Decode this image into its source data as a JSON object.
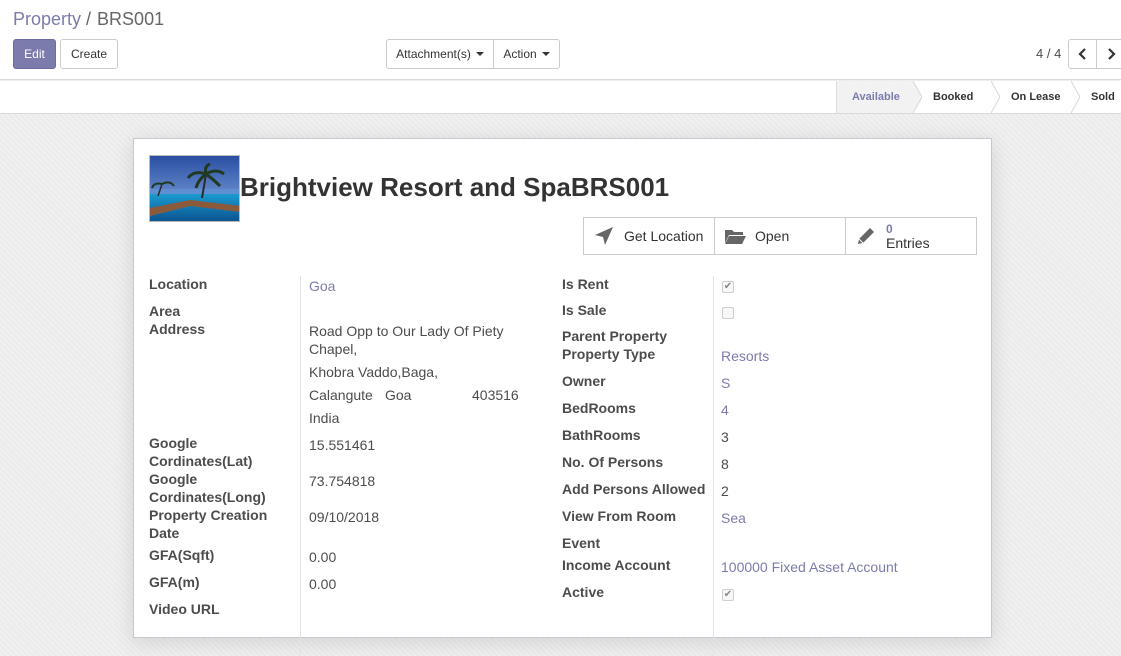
{
  "breadcrumb": {
    "parent": "Property",
    "separator": "/",
    "current": "BRS001"
  },
  "toolbar": {
    "edit_label": "Edit",
    "create_label": "Create",
    "attachments_label": "Attachment(s)",
    "action_label": "Action"
  },
  "pager": {
    "value": "4 / 4"
  },
  "stages": [
    {
      "label": "Available",
      "active": true
    },
    {
      "label": "Booked",
      "active": false
    },
    {
      "label": "On Lease",
      "active": false
    },
    {
      "label": "Sold",
      "active": false
    }
  ],
  "record": {
    "title": "Brightview Resort and SpaBRS001"
  },
  "smart_buttons": {
    "get_location": "Get Location",
    "open": "Open",
    "entries_count": "0",
    "entries_label": "Entries"
  },
  "left_fields": {
    "location_label": "Location",
    "location_value": "Goa",
    "area_label": "Area",
    "address_label": "Address",
    "address_street": "Road Opp to Our Lady Of Piety",
    "address_street_cont": "Chapel,",
    "address_street2": "Khobra Vaddo,Baga,",
    "address_city": "Calangute",
    "address_state": "Goa",
    "address_zip": "403516",
    "address_country": "India",
    "lat_label_1": "Google",
    "lat_label_2": "Cordinates(Lat)",
    "lat_value": "15.551461",
    "long_label_1": "Google",
    "long_label_2": "Cordinates(Long)",
    "long_value": "73.754818",
    "created_label_1": "Property Creation",
    "created_label_2": "Date",
    "created_value": "09/10/2018",
    "gfa_sqft_label": "GFA(Sqft)",
    "gfa_sqft_value": "0.00",
    "gfa_m_label": "GFA(m)",
    "gfa_m_value": "0.00",
    "video_label": "Video URL"
  },
  "right_fields": {
    "is_rent_label": "Is Rent",
    "is_rent": true,
    "is_sale_label": "Is Sale",
    "is_sale": false,
    "parent_label": "Parent Property",
    "type_label": "Property Type",
    "type_value": "Resorts",
    "owner_label": "Owner",
    "owner_value": "S",
    "bedrooms_label": "BedRooms",
    "bedrooms_value": "4",
    "bathrooms_label": "BathRooms",
    "bathrooms_value": "3",
    "persons_label": "No. Of Persons",
    "persons_value": "8",
    "add_persons_label": "Add Persons Allowed",
    "add_persons_value": "2",
    "view_label": "View From Room",
    "view_value": "Sea",
    "event_label": "Event",
    "income_label": "Income Account",
    "income_value": "100000 Fixed Asset Account",
    "active_label": "Active",
    "active": true
  },
  "colors": {
    "accent": "#7c7bad",
    "text": "#4c4c4c",
    "border": "#cccccc"
  }
}
